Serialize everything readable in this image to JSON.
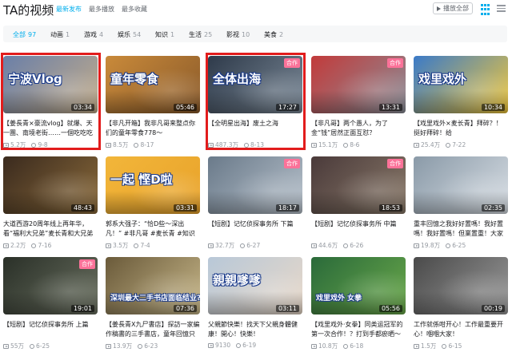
{
  "header": {
    "title": "TA的视频",
    "sort_tabs": [
      "最新发布",
      "最多播放",
      "最多收藏"
    ],
    "play_all": "播放全部",
    "colors": {
      "accent": "#00aeec",
      "highlight": "#e21c1c",
      "badge": "#fb7299"
    }
  },
  "categories": [
    {
      "label": "全部",
      "count": "97",
      "active": true
    },
    {
      "label": "动画",
      "count": "1"
    },
    {
      "label": "游戏",
      "count": "4"
    },
    {
      "label": "娱乐",
      "count": "54"
    },
    {
      "label": "知识",
      "count": "1"
    },
    {
      "label": "生活",
      "count": "25"
    },
    {
      "label": "影视",
      "count": "10"
    },
    {
      "label": "美食",
      "count": "2"
    }
  ],
  "videos": [
    {
      "title": "【姜長青×豪流vlog】就爆、天一團、南境老街……一個吃吃吃的一天！",
      "views": "5.2万",
      "date": "9-8",
      "duration": "03:34",
      "thumb_text": "宁波Vlog",
      "badge": "",
      "highlighted": true,
      "colors": [
        "#6a7fa8",
        "#c4ad8a"
      ]
    },
    {
      "title": "【非凡开箱】我非凡哥来整点你们的童年零食778～",
      "views": "8.5万",
      "date": "8-17",
      "duration": "05:46",
      "thumb_text": "童年零食",
      "badge": "",
      "highlighted": false,
      "colors": [
        "#c98a3a",
        "#8a5a2a"
      ]
    },
    {
      "title": "【全明星出海】废土之海",
      "views": "487.3万",
      "date": "8-13",
      "duration": "17:27",
      "thumb_text": "全体出海",
      "badge": "合作",
      "highlighted": true,
      "colors": [
        "#2e3a4a",
        "#7c8a98"
      ]
    },
    {
      "title": "【非凡哥】两个愚人，为了金“钱”居然正面互怼？",
      "views": "15.1万",
      "date": "8-6",
      "duration": "13:31",
      "thumb_text": "",
      "badge": "合作",
      "highlighted": false,
      "colors": [
        "#c23a3a",
        "#8a8f99"
      ]
    },
    {
      "title": "【戏里戏外×麦长青】拜碎？！挺好拜碎！给",
      "views": "25.4万",
      "date": "7-22",
      "duration": "10:34",
      "thumb_text": "戏里戏外",
      "badge": "",
      "highlighted": false,
      "colors": [
        "#3a7ac8",
        "#f2c83a"
      ]
    },
    {
      "title": "大道西游20周年线上再年华，看“福利大兄弟”麦长青和大兄弟团一起",
      "views": "2.2万",
      "date": "7-16",
      "duration": "48:43",
      "thumb_text": "",
      "badge": "",
      "highlighted": false,
      "colors": [
        "#3a2a1e",
        "#8a6a3a"
      ]
    },
    {
      "title": "郭系大强子：“恰D些～深出凡！” #非凡哥 #麦长青 #知识权益",
      "views": "3.5万",
      "date": "7-4",
      "duration": "03:31",
      "thumb_text": "一起 悭D啦",
      "badge": "",
      "highlighted": false,
      "colors": [
        "#f2b63a",
        "#e8a22a"
      ]
    },
    {
      "title": "【短剧】记忆侦探事务所 下篇",
      "views": "32.7万",
      "date": "6-27",
      "duration": "18:17",
      "thumb_text": "",
      "badge": "合作",
      "highlighted": false,
      "colors": [
        "#6a7a8a",
        "#b8c2cc"
      ]
    },
    {
      "title": "【短剧】记忆侦探事务所 中篇",
      "views": "44.6万",
      "date": "6-26",
      "duration": "18:53",
      "thumb_text": "",
      "badge": "合作",
      "highlighted": false,
      "colors": [
        "#4a3a3a",
        "#8a7a6a"
      ]
    },
    {
      "title": "重丰回憶之我好好置嗎！我好置嗎！我好置嗎！但業置重！大家不要",
      "views": "19.8万",
      "date": "6-25",
      "duration": "02:35",
      "thumb_text": "",
      "badge": "",
      "highlighted": false,
      "colors": [
        "#8a9aa8",
        "#d8dee4"
      ]
    },
    {
      "title": "【短剧】记忆侦探事务所 上篇",
      "views": "55万",
      "date": "6-25",
      "duration": "19:01",
      "thumb_text": "",
      "badge": "合作",
      "highlighted": false,
      "colors": [
        "#2a3028",
        "#6a7060"
      ]
    },
    {
      "title": "【姜長青X九尸書店】探訪一家編作稿書的三手書店，童年回憶只要111",
      "views": "13.9万",
      "date": "6-23",
      "duration": "07:36",
      "thumb_text": "深圳最大二手书店面临结业?",
      "badge": "",
      "highlighted": false,
      "colors": [
        "#6a5a3a",
        "#c8b88a"
      ]
    },
    {
      "title": "父親節快樂！找天下父親身體健康！開心！快樂！",
      "views": "9130",
      "date": "6-19",
      "duration": "03:11",
      "thumb_text": "親親嗲嗲",
      "badge": "",
      "highlighted": false,
      "colors": [
        "#b8c8d8",
        "#e8d8c8"
      ]
    },
    {
      "title": "【戏里戏外·女拳】同类运冠军的第一次合作！？打到手都瘀晒～～～！",
      "views": "10.8万",
      "date": "6-18",
      "duration": "05:56",
      "thumb_text": "戏里戏外 女拳",
      "badge": "",
      "highlighted": false,
      "colors": [
        "#2a6a3a",
        "#6aa84a"
      ]
    },
    {
      "title": "工作就係咁开心！工作最重要开心！嗰嗰大家！",
      "views": "1.5万",
      "date": "6-15",
      "duration": "00:19",
      "thumb_text": "",
      "badge": "",
      "highlighted": false,
      "colors": [
        "#4a4a4a",
        "#9a9a9a"
      ]
    }
  ]
}
